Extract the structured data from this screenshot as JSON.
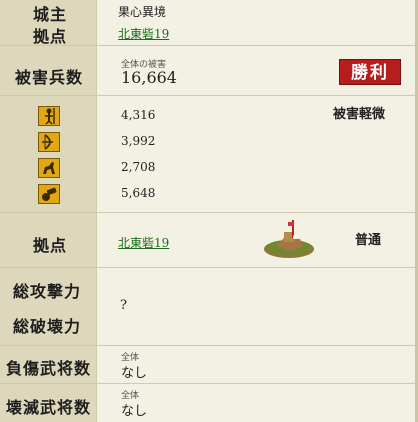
{
  "castle": {
    "owner_label": "城主",
    "owner_value": "果心異境",
    "base_label": "拠点",
    "base_link": "北東砦19"
  },
  "damage": {
    "label": "被害兵数",
    "total_caption": "全体の被害",
    "total_value": "16,664",
    "victory_badge": "勝利"
  },
  "units": {
    "assessment": "被害軽微",
    "rows": [
      {
        "icon": "spearman-icon",
        "value": "4,316"
      },
      {
        "icon": "archer-icon",
        "value": "3,992"
      },
      {
        "icon": "cavalry-icon",
        "value": "2,708"
      },
      {
        "icon": "siege-icon",
        "value": "5,648"
      }
    ]
  },
  "base_row": {
    "label": "拠点",
    "link": "北東砦19",
    "status": "普通",
    "image_icon": "fortress-icon"
  },
  "power": {
    "attack_label": "総攻撃力",
    "destroy_label": "総破壊力",
    "value": "?"
  },
  "wounded": {
    "label": "負傷武将数",
    "caption": "全体",
    "value": "なし"
  },
  "destroyed": {
    "label": "壊滅武将数",
    "caption": "全体",
    "value": "なし"
  },
  "colors": {
    "label_bg": "#ddd8bc",
    "content_bg": "#f3f1e4",
    "victory_red": "#b61d1d",
    "link_green": "#1a6b1a",
    "icon_gold": "#e2a814"
  }
}
